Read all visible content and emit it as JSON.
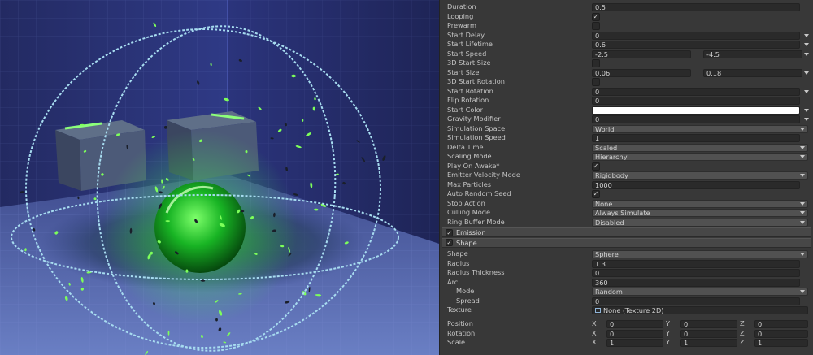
{
  "colors": {
    "panel_bg": "#383838",
    "field_bg": "#2a2a2a",
    "dropdown_bg": "#515151",
    "section_bg": "#474747",
    "gizmo": "#9fd6ec",
    "glow": "#3cff4a",
    "scene_wall": "#2c3170",
    "scene_floor": "#4a5ca8"
  },
  "main": {
    "rows": [
      {
        "label": "Duration",
        "type": "text",
        "value": "0.5"
      },
      {
        "label": "Looping",
        "type": "check",
        "checked": true
      },
      {
        "label": "Prewarm",
        "type": "check",
        "checked": false
      },
      {
        "label": "Start Delay",
        "type": "text",
        "value": "0",
        "outside_arrow": true
      },
      {
        "label": "Start Lifetime",
        "type": "text",
        "value": "0.6",
        "outside_arrow": true
      },
      {
        "label": "Start Speed",
        "type": "two",
        "values": [
          "-2.5",
          "-4.5"
        ],
        "outside_arrow": true
      },
      {
        "label": "3D Start Size",
        "type": "check",
        "checked": false
      },
      {
        "label": "Start Size",
        "type": "two",
        "values": [
          "0.06",
          "0.18"
        ],
        "outside_arrow": true
      },
      {
        "label": "3D Start Rotation",
        "type": "check",
        "checked": false
      },
      {
        "label": "Start Rotation",
        "type": "text",
        "value": "0",
        "outside_arrow": true
      },
      {
        "label": "Flip Rotation",
        "type": "text",
        "value": "0"
      },
      {
        "label": "Start Color",
        "type": "color",
        "color": "#ffffff",
        "outside_arrow": true
      },
      {
        "label": "Gravity Modifier",
        "type": "text",
        "value": "0",
        "outside_arrow": true
      },
      {
        "label": "Simulation Space",
        "type": "drop",
        "value": "World"
      },
      {
        "label": "Simulation Speed",
        "type": "text",
        "value": "1"
      },
      {
        "label": "Delta Time",
        "type": "drop",
        "value": "Scaled"
      },
      {
        "label": "Scaling Mode",
        "type": "drop",
        "value": "Hierarchy"
      },
      {
        "label": "Play On Awake*",
        "type": "check",
        "checked": true
      },
      {
        "label": "Emitter Velocity Mode",
        "type": "drop",
        "value": "Rigidbody"
      },
      {
        "label": "Max Particles",
        "type": "text",
        "value": "1000"
      },
      {
        "label": "Auto Random Seed",
        "type": "check",
        "checked": true
      },
      {
        "label": "Stop Action",
        "type": "drop",
        "value": "None"
      },
      {
        "label": "Culling Mode",
        "type": "drop",
        "value": "Always Simulate"
      },
      {
        "label": "Ring Buffer Mode",
        "type": "drop",
        "value": "Disabled"
      }
    ]
  },
  "sections": [
    {
      "title": "Emission",
      "enabled": true
    },
    {
      "title": "Shape",
      "enabled": true
    }
  ],
  "shape": {
    "rows": [
      {
        "label": "Shape",
        "type": "drop",
        "value": "Sphere"
      },
      {
        "label": "Radius",
        "type": "text",
        "value": "1.3"
      },
      {
        "label": "Radius Thickness",
        "type": "text",
        "value": "0"
      },
      {
        "label": "Arc",
        "type": "text",
        "value": "360"
      },
      {
        "label": "Mode",
        "type": "drop",
        "value": "Random",
        "indent": true
      },
      {
        "label": "Spread",
        "type": "text",
        "value": "0",
        "indent": true
      },
      {
        "label": "Texture",
        "type": "object",
        "value": "None (Texture 2D)"
      }
    ],
    "transforms": [
      {
        "label": "Position",
        "x": "0",
        "y": "0",
        "z": "0"
      },
      {
        "label": "Rotation",
        "x": "0",
        "y": "0",
        "z": "0"
      },
      {
        "label": "Scale",
        "x": "1",
        "y": "1",
        "z": "1"
      }
    ],
    "axis_labels": [
      "X",
      "Y",
      "Z"
    ]
  }
}
